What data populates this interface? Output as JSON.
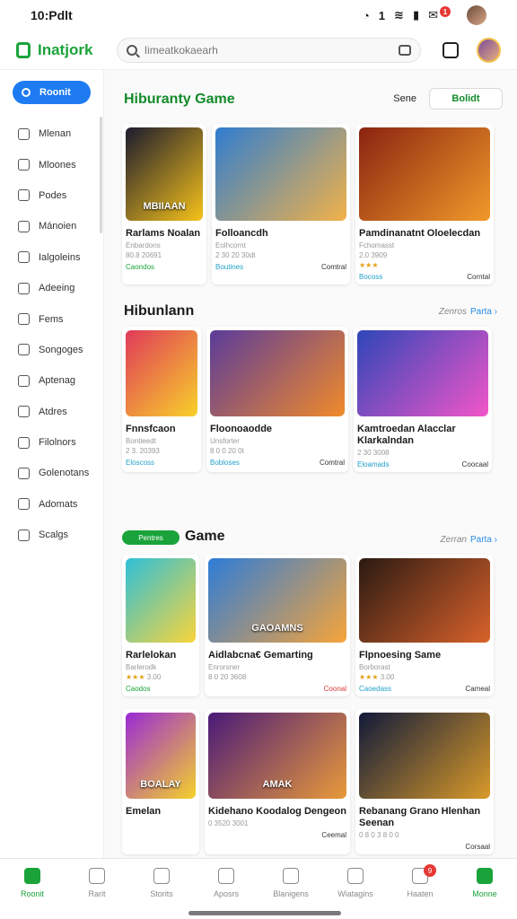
{
  "status": {
    "time": "10:Pdlt",
    "badge": "1",
    "signal": "1"
  },
  "header": {
    "app_name": "Inatjork",
    "search_placeholder": "Iimeatkokaearh"
  },
  "sidebar": {
    "active": "Roonit",
    "items": [
      "Mlenan",
      "Mloones",
      "Podes",
      "Mánoien",
      "Ialgoleins",
      "Adeeing",
      "Fems",
      "Songoges",
      "Aptenag",
      "Atdres",
      "Filolnors",
      "Golenotans",
      "Adomats",
      "Scalgs"
    ]
  },
  "sections": [
    {
      "title": "Hiburanty Game",
      "sort_label": "Sene",
      "sort_button": "Bolidt",
      "cards": [
        {
          "thumb_text": "MBIIAAN",
          "title": "Rarlams Noalan",
          "meta1": "Enbardons",
          "meta2": "80.8 20691",
          "tag": "Caondos",
          "cta": "",
          "colors": [
            "#1b1b2e",
            "#f6c21a"
          ]
        },
        {
          "thumb_text": "",
          "title": "Folloancdh",
          "meta1": "Eolhcornt",
          "meta2": "2 30 20 30dt",
          "tag": "Boutines",
          "cta": "Comtral",
          "colors": [
            "#2f7dd1",
            "#f2b248"
          ]
        },
        {
          "thumb_text": "",
          "title": "Pamdinanatnt Oloelecdan",
          "meta1": "Fchomasst",
          "meta2": "2.0 3909",
          "tag": "Bocoss",
          "cta": "Corntal",
          "stars": "★★★",
          "colors": [
            "#8a2310",
            "#f19a2a"
          ]
        }
      ]
    },
    {
      "title": "Hibunlann",
      "link_label": "Zenros",
      "link": "Parta",
      "cards": [
        {
          "thumb_text": "",
          "title": "Fnnsfcaon",
          "meta1": "Bontieedt",
          "meta2": "2 3. 20393",
          "tag": "Eloscoss",
          "cta": "",
          "colors": [
            "#e03a5a",
            "#f7d12a"
          ]
        },
        {
          "thumb_text": "",
          "title": "Floonoaodde",
          "meta1": "Unsforter",
          "meta2": "8 0 0 20 0t",
          "tag": "Bobloses",
          "cta": "Comtral",
          "colors": [
            "#5a3b9a",
            "#f08a2a"
          ]
        },
        {
          "thumb_text": "",
          "title": "Kamtroedan Alacclar Klarkalndan",
          "meta1": "",
          "meta2": "2 30 3008",
          "tag": "Eloamads",
          "cta": "Coocaal",
          "colors": [
            "#2d46b8",
            "#f256c8"
          ]
        }
      ]
    },
    {
      "title": "Game",
      "pill": "Pentres",
      "link_label": "Zerran",
      "link": "Parta",
      "cards": [
        {
          "thumb_text": "",
          "title": "Rarlelokan",
          "meta1": "Barlerodk",
          "meta2": "",
          "stars": "★★★",
          "meta3": "3.00",
          "tag": "Caodos",
          "cta": "",
          "colors": [
            "#2fc0d9",
            "#f9d43a"
          ]
        },
        {
          "thumb_text": "GAOAMNS",
          "title": "Aidlabcna€ Gemarting",
          "meta1": "Enrorsner",
          "meta2": "8 0 20 3608",
          "tag": "",
          "cta": "Coonal",
          "cta_red": true,
          "colors": [
            "#2d7cd8",
            "#f7a43a"
          ]
        },
        {
          "thumb_text": "",
          "title": "Flpnoesing Same",
          "meta1": "Borborast",
          "meta2": "",
          "stars": "★★★",
          "meta3": "3.00",
          "tag": "Caoedass",
          "cta": "Cameal",
          "colors": [
            "#2a1a12",
            "#d9622a"
          ]
        }
      ]
    },
    {
      "cards": [
        {
          "thumb_text": "BOALAY",
          "title": "Emelan",
          "meta1": "",
          "meta2": "",
          "tag": "",
          "cta": "",
          "colors": [
            "#9a2ad6",
            "#f4d12a"
          ]
        },
        {
          "thumb_text": "AMAK",
          "title": "Kidehano Koodalog Dengeon",
          "meta1": "",
          "meta2": "0 3520 3001",
          "tag": "",
          "cta": "Ceemal",
          "colors": [
            "#4a1a78",
            "#e89a3a"
          ]
        },
        {
          "thumb_text": "",
          "title": "Rebanang Grano Hlenhan Seenan",
          "meta1": "",
          "meta2": "0 8 0 3 8 0 0",
          "tag": "",
          "cta": "Corsaal",
          "colors": [
            "#101a3a",
            "#d99a2a"
          ]
        }
      ]
    }
  ],
  "bottom_nav": [
    {
      "label": "Roonit",
      "active": true
    },
    {
      "label": "Rarit"
    },
    {
      "label": "Storits"
    },
    {
      "label": "Aposrs"
    },
    {
      "label": "Blanigens"
    },
    {
      "label": "Wiatagins"
    },
    {
      "label": "Haaten",
      "badge": "9"
    },
    {
      "label": "Monne",
      "active": true
    }
  ]
}
